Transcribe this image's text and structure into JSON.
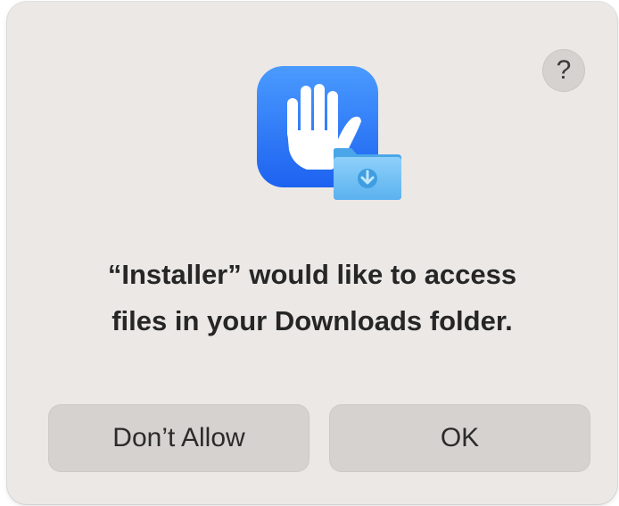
{
  "dialog": {
    "help_label": "?",
    "icon": {
      "app_icon": "raised-hand-privacy-icon",
      "badge_icon": "downloads-folder-icon",
      "colors": {
        "tile_top": "#4a9bff",
        "tile_bottom": "#1d62f0",
        "hand": "#ffffff",
        "folder": "#6ec0f5",
        "folder_dark": "#3f9de0"
      }
    },
    "message_lines": [
      "“Installer” would like to access",
      "files in your Downloads folder."
    ],
    "buttons": {
      "deny_label": "Don’t Allow",
      "ok_label": "OK"
    }
  }
}
